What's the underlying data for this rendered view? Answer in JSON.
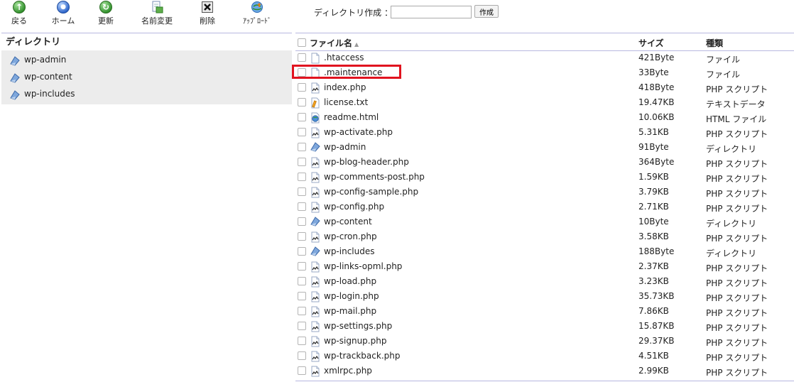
{
  "toolbar": {
    "back": {
      "label": "戻る",
      "icon": "back-arrow-icon"
    },
    "home": {
      "label": "ホーム",
      "icon": "home-icon"
    },
    "refresh": {
      "label": "更新",
      "icon": "refresh-icon"
    },
    "rename": {
      "label": "名前変更",
      "icon": "rename-icon"
    },
    "delete": {
      "label": "削除",
      "icon": "delete-icon"
    },
    "upload": {
      "label": "ｱｯﾌﾟﾛｰﾄﾞ",
      "icon": "upload-icon"
    }
  },
  "mkdir": {
    "label": "ディレクトリ作成 ：",
    "value": "",
    "button": "作成"
  },
  "sidebar": {
    "header": "ディレクトリ",
    "items": [
      {
        "label": "wp-admin"
      },
      {
        "label": "wp-content"
      },
      {
        "label": "wp-includes"
      }
    ]
  },
  "file_list": {
    "columns": {
      "name": "ファイル名",
      "size": "サイズ",
      "type": "種類"
    },
    "rows": [
      {
        "name": ".htaccess",
        "size": "421Byte",
        "type": "ファイル",
        "icon": "file-icon"
      },
      {
        "name": ".maintenance",
        "size": "33Byte",
        "type": "ファイル",
        "icon": "file-icon"
      },
      {
        "name": "index.php",
        "size": "418Byte",
        "type": "PHP スクリプト",
        "icon": "php-icon"
      },
      {
        "name": "license.txt",
        "size": "19.47KB",
        "type": "テキストデータ",
        "icon": "text-icon"
      },
      {
        "name": "readme.html",
        "size": "10.06KB",
        "type": "HTML ファイル",
        "icon": "html-icon"
      },
      {
        "name": "wp-activate.php",
        "size": "5.31KB",
        "type": "PHP スクリプト",
        "icon": "php-icon"
      },
      {
        "name": "wp-admin",
        "size": "91Byte",
        "type": "ディレクトリ",
        "icon": "folder-icon"
      },
      {
        "name": "wp-blog-header.php",
        "size": "364Byte",
        "type": "PHP スクリプト",
        "icon": "php-icon"
      },
      {
        "name": "wp-comments-post.php",
        "size": "1.59KB",
        "type": "PHP スクリプト",
        "icon": "php-icon"
      },
      {
        "name": "wp-config-sample.php",
        "size": "3.79KB",
        "type": "PHP スクリプト",
        "icon": "php-icon"
      },
      {
        "name": "wp-config.php",
        "size": "2.71KB",
        "type": "PHP スクリプト",
        "icon": "php-icon"
      },
      {
        "name": "wp-content",
        "size": "10Byte",
        "type": "ディレクトリ",
        "icon": "folder-icon"
      },
      {
        "name": "wp-cron.php",
        "size": "3.58KB",
        "type": "PHP スクリプト",
        "icon": "php-icon"
      },
      {
        "name": "wp-includes",
        "size": "188Byte",
        "type": "ディレクトリ",
        "icon": "folder-icon"
      },
      {
        "name": "wp-links-opml.php",
        "size": "2.37KB",
        "type": "PHP スクリプト",
        "icon": "php-icon"
      },
      {
        "name": "wp-load.php",
        "size": "3.23KB",
        "type": "PHP スクリプト",
        "icon": "php-icon"
      },
      {
        "name": "wp-login.php",
        "size": "35.73KB",
        "type": "PHP スクリプト",
        "icon": "php-icon"
      },
      {
        "name": "wp-mail.php",
        "size": "7.86KB",
        "type": "PHP スクリプト",
        "icon": "php-icon"
      },
      {
        "name": "wp-settings.php",
        "size": "15.87KB",
        "type": "PHP スクリプト",
        "icon": "php-icon"
      },
      {
        "name": "wp-signup.php",
        "size": "29.37KB",
        "type": "PHP スクリプト",
        "icon": "php-icon"
      },
      {
        "name": "wp-trackback.php",
        "size": "4.51KB",
        "type": "PHP スクリプト",
        "icon": "php-icon"
      },
      {
        "name": "xmlrpc.php",
        "size": "2.99KB",
        "type": "PHP スクリプト",
        "icon": "php-icon"
      }
    ]
  },
  "colors": {
    "highlight": "#e1131f",
    "divider": "#b8b8e0",
    "tree_bg": "#ececec"
  }
}
